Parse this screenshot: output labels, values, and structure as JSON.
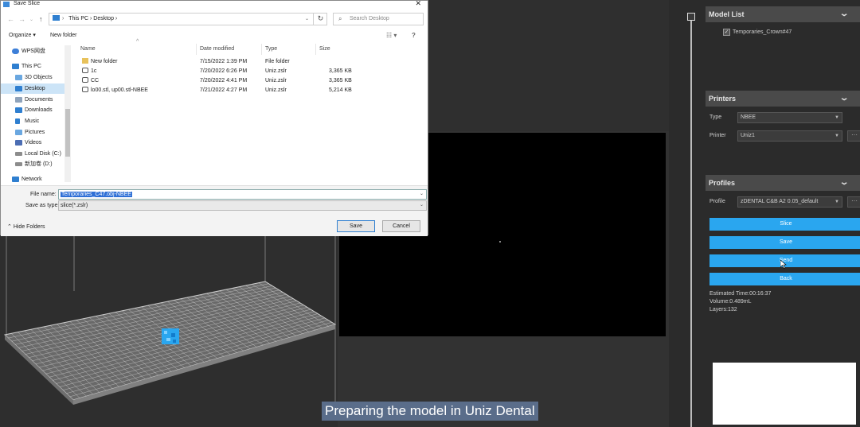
{
  "dialog": {
    "title": "Save Slice",
    "breadcrumb": "This PC  ›  Desktop  ›",
    "search_placeholder": "Search Desktop",
    "toolbar": {
      "organize": "Organize ▾",
      "new_folder": "New folder"
    },
    "nav_items": [
      {
        "label": "WPS网盘",
        "icon": "cloud-icon",
        "color": "#3d7fd8"
      },
      {
        "label": "This PC",
        "icon": "computer-icon",
        "color": "#2f7fd0"
      },
      {
        "label": "3D Objects",
        "icon": "cube-icon",
        "color": "#6aa7e0"
      },
      {
        "label": "Desktop",
        "icon": "desktop-icon",
        "color": "#2f7fd0"
      },
      {
        "label": "Documents",
        "icon": "document-icon",
        "color": "#8fa3bb"
      },
      {
        "label": "Downloads",
        "icon": "download-icon",
        "color": "#2f7fd0"
      },
      {
        "label": "Music",
        "icon": "music-icon",
        "color": "#2f7fd0"
      },
      {
        "label": "Pictures",
        "icon": "picture-icon",
        "color": "#6aa7e0"
      },
      {
        "label": "Videos",
        "icon": "video-icon",
        "color": "#4b6db3"
      },
      {
        "label": "Local Disk (C:)",
        "icon": "disk-icon",
        "color": "#8c8c8c"
      },
      {
        "label": "新加卷 (D:)",
        "icon": "disk-icon",
        "color": "#8c8c8c"
      },
      {
        "label": "Network",
        "icon": "network-icon",
        "color": "#2f7fd0"
      }
    ],
    "columns": [
      "Name",
      "Date modified",
      "Type",
      "Size"
    ],
    "files": [
      {
        "name": "New folder",
        "date": "7/15/2022 1:39 PM",
        "type": "File folder",
        "size": "",
        "kind": "folder"
      },
      {
        "name": "1c",
        "date": "7/20/2022 6:26 PM",
        "type": "Uniz.zslr",
        "size": "3,365 KB",
        "kind": "file"
      },
      {
        "name": "CC",
        "date": "7/20/2022 4:41 PM",
        "type": "Uniz.zslr",
        "size": "3,365 KB",
        "kind": "file"
      },
      {
        "name": "lo00.stl, up00.stl-NBEE",
        "date": "7/21/2022 4:27 PM",
        "type": "Uniz.zslr",
        "size": "5,214 KB",
        "kind": "file"
      }
    ],
    "file_name_label": "File name:",
    "file_name_value": "Temporaries_C47.obj-NBEE",
    "save_type_label": "Save as type:",
    "save_type_value": "slice(*.zslr)",
    "hide_folders": "Hide Folders",
    "save_label": "Save",
    "cancel_label": "Cancel"
  },
  "panel": {
    "model_list": {
      "title": "Model List",
      "item": "Temporaries_Crown#47"
    },
    "printers": {
      "title": "Printers",
      "type_label": "Type",
      "type_value": "NBEE",
      "printer_label": "Printer",
      "printer_value": "Uniz1"
    },
    "profiles": {
      "title": "Profiles",
      "profile_label": "Profile",
      "profile_value": "zDENTAL C&B A2 0.05_default"
    },
    "buttons": {
      "slice": "Slice",
      "save": "Save",
      "send": "Send",
      "back": "Back"
    },
    "stats": {
      "time": "Estimated Time:00:16:37",
      "volume": "Volume:0.489mL",
      "layers": "Layers:132"
    }
  },
  "caption": "Preparing the model in Uniz Dental",
  "colors": {
    "accent": "#2aa6ef",
    "model": "#2aa6ef"
  }
}
